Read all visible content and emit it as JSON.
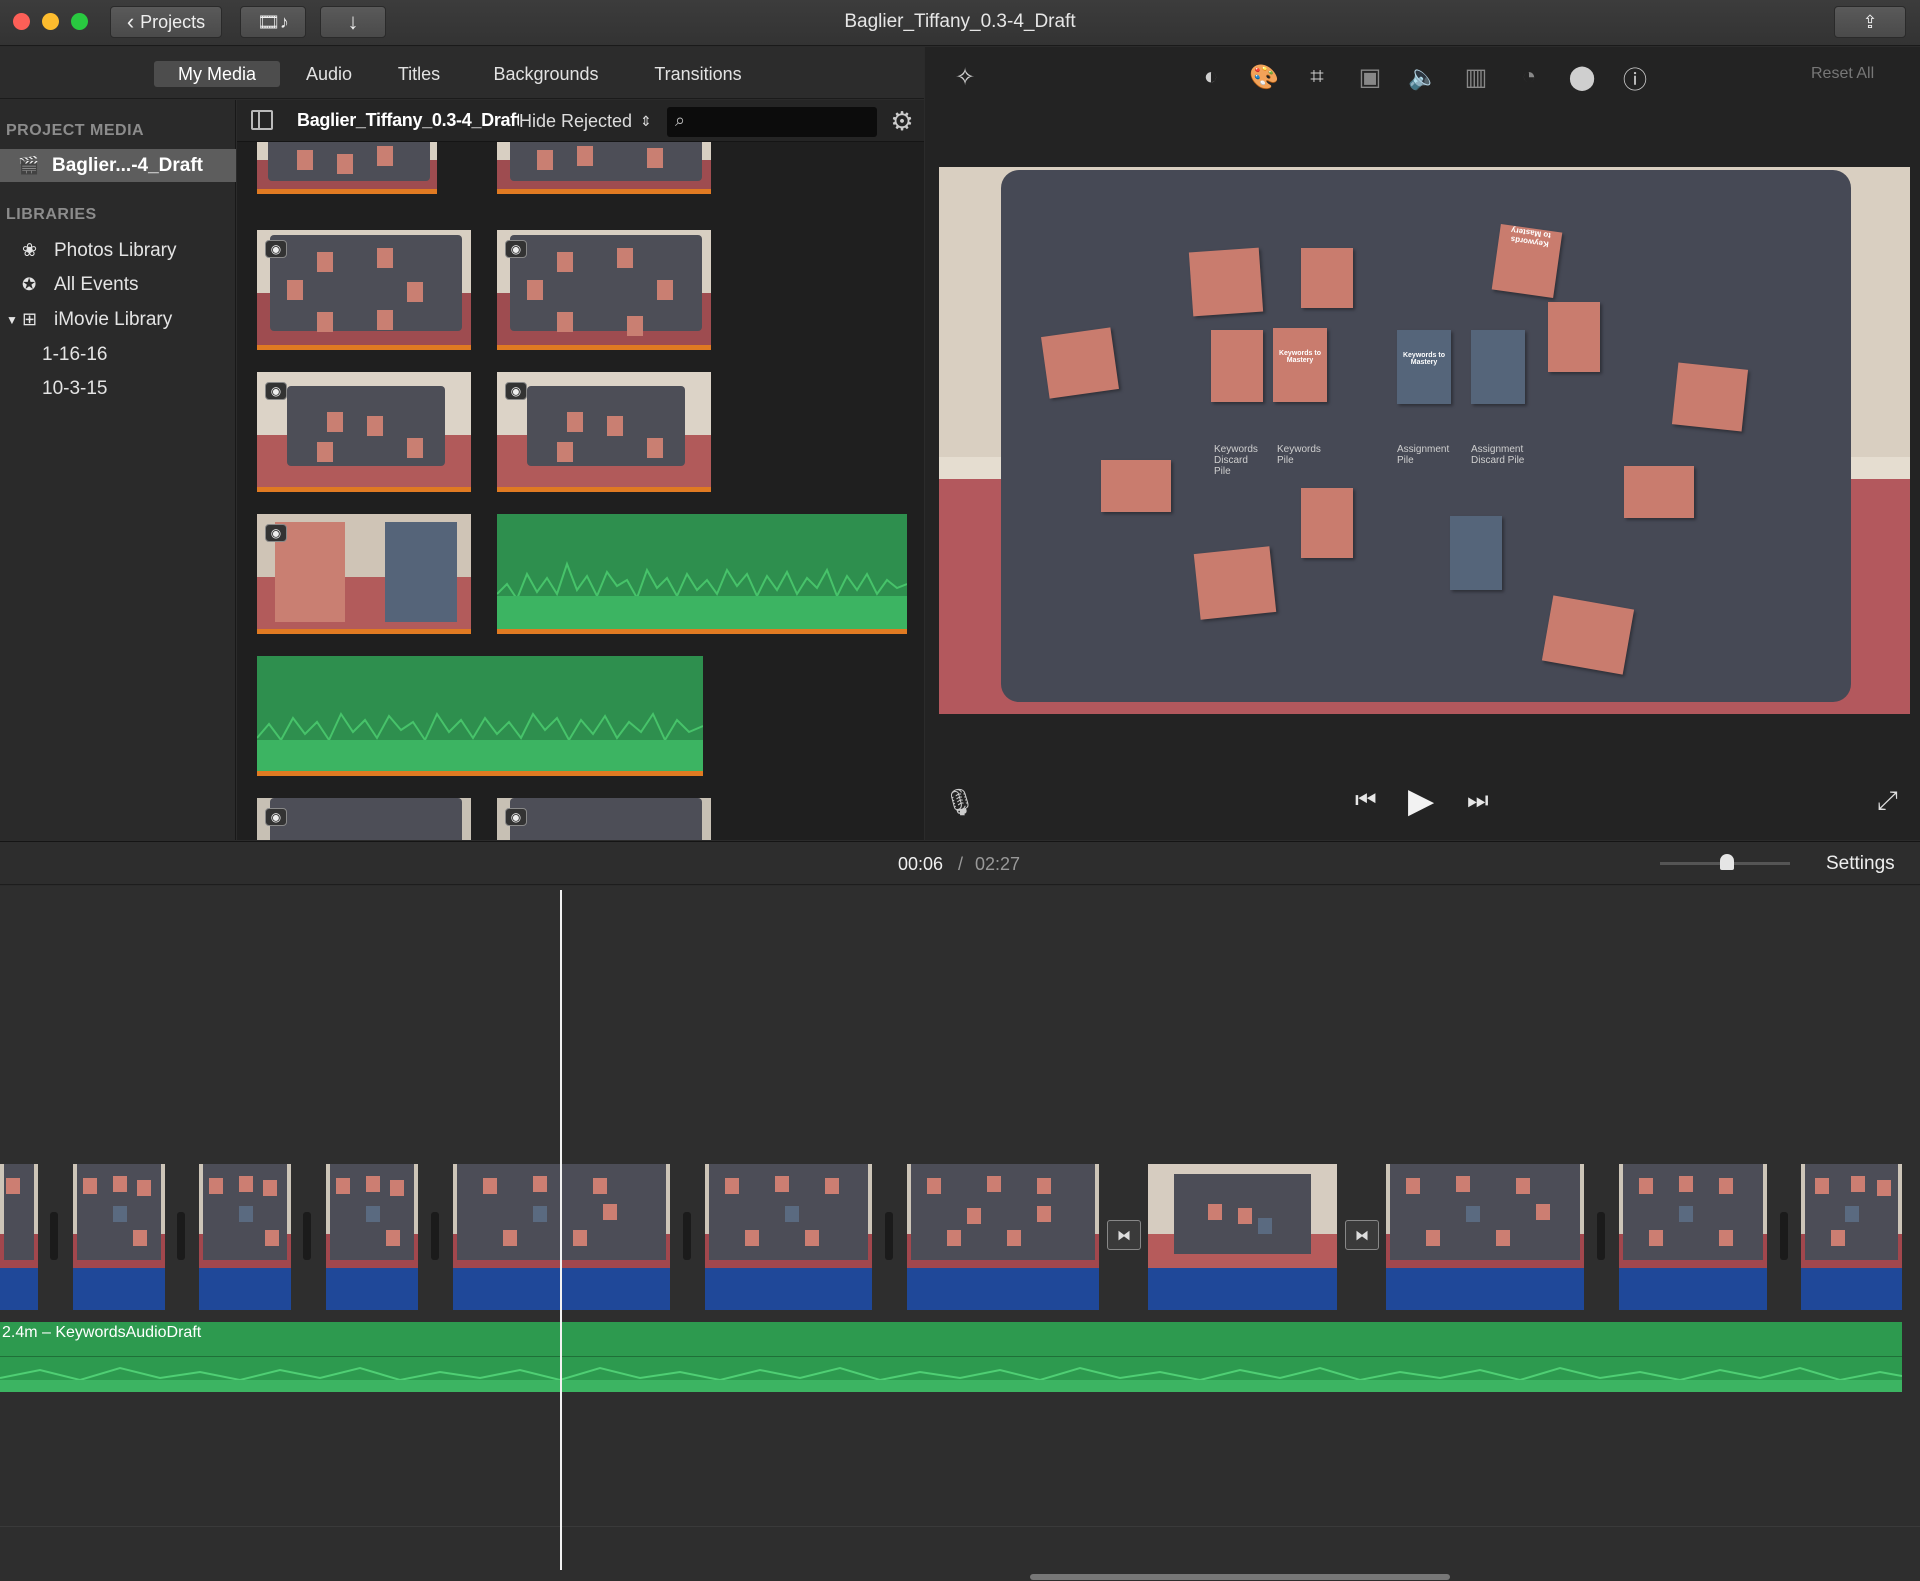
{
  "window": {
    "title": "Baglier_Tiffany_0.3-4_Draft"
  },
  "toolbar": {
    "projects_label": "Projects"
  },
  "tabs": [
    {
      "label": "My Media",
      "active": true
    },
    {
      "label": "Audio",
      "active": false
    },
    {
      "label": "Titles",
      "active": false
    },
    {
      "label": "Backgrounds",
      "active": false
    },
    {
      "label": "Transitions",
      "active": false
    }
  ],
  "sidebar": {
    "project_media_heading": "PROJECT MEDIA",
    "project_item": "Baglier...-4_Draft",
    "libraries_heading": "LIBRARIES",
    "libraries": [
      {
        "label": "Photos Library",
        "icon": "flower-icon"
      },
      {
        "label": "All Events",
        "icon": "star-icon"
      },
      {
        "label": "iMovie Library",
        "icon": "grid-icon"
      }
    ],
    "events": [
      "1-16-16",
      "10-3-15"
    ]
  },
  "browser": {
    "project_name": "Baglier_Tiffany_0.3-4_Draft",
    "filter": "Hide Rejected",
    "search_placeholder": ""
  },
  "viewer": {
    "reset_all": "Reset All",
    "labels": {
      "keywords_discard": "Keywords Discard Pile",
      "keywords_pile": "Keywords Pile",
      "assignment_pile": "Assignment Pile",
      "assignment_discard": "Assignment Discard Pile",
      "card_title": "Keywords to Mastery"
    }
  },
  "timeline": {
    "current_time": "00:06",
    "separator": "/",
    "total_time": "02:27",
    "settings_label": "Settings",
    "audio_clip_label": "2.4m – KeywordsAudioDraft"
  },
  "colors": {
    "audio_green": "#2d9a4f",
    "video_blue": "#1f4899",
    "selection_orange": "#e07a22"
  }
}
